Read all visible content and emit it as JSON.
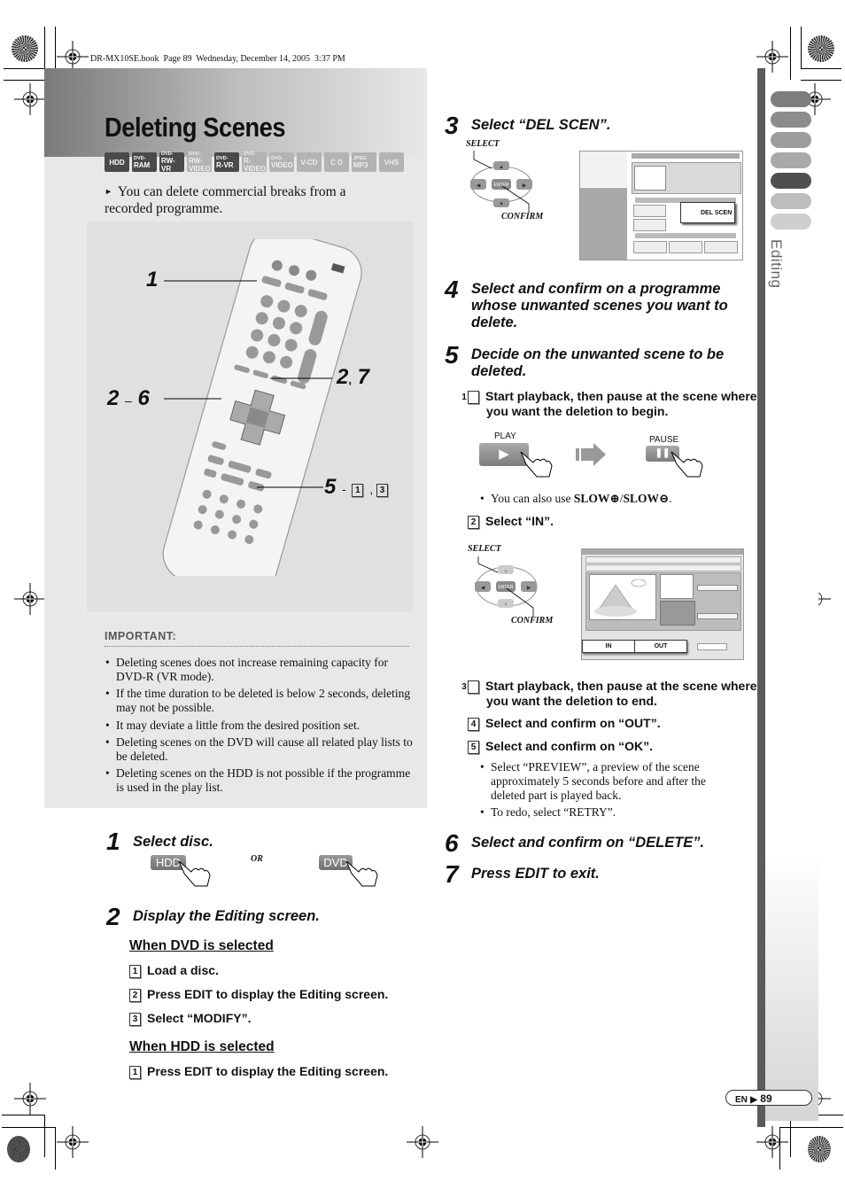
{
  "print_header": "DR-MX10SE.book  Page 89  Wednesday, December 14, 2005  3:37 PM",
  "title": "Deleting Scenes",
  "formats": [
    {
      "top": "",
      "label": "HDD",
      "active": true
    },
    {
      "top": "DVD-",
      "label": "RAM",
      "active": true
    },
    {
      "top": "DVD-",
      "label": "RW-VR",
      "active": true
    },
    {
      "top": "DVD-",
      "label": "RW-VIDEO",
      "active": false
    },
    {
      "top": "DVD-",
      "label": "R-VR",
      "active": true
    },
    {
      "top": "DVD-",
      "label": "R-VIDEO",
      "active": false
    },
    {
      "top": "DVD-",
      "label": "VIDEO",
      "active": false
    },
    {
      "top": "",
      "label": "V-CD",
      "active": false
    },
    {
      "top": "",
      "label": "C D",
      "active": false
    },
    {
      "top": "JPEG",
      "label": "MP3",
      "active": false
    },
    {
      "top": "",
      "label": "VHS",
      "active": false
    }
  ],
  "intro": "You can delete commercial breaks from a recorded programme.",
  "remote_callouts": {
    "c1": "1",
    "c27_a": "2",
    "c27_sep": ",",
    "c27_b": "7",
    "c26_a": "2",
    "c26_sep": "–",
    "c26_b": "6",
    "c5": "5",
    "c5_sep": "-",
    "c5_box1": "1",
    "c5_comma": ",",
    "c5_box2": "3"
  },
  "important": {
    "heading": "IMPORTANT:",
    "items": [
      "Deleting scenes does not increase remaining capacity for DVD-R (VR mode).",
      "If the time duration to be deleted is below 2 seconds, deleting may not be possible.",
      "It may deviate a little from the desired position set.",
      "Deleting scenes on the DVD will cause all related play lists to be deleted.",
      "Deleting scenes on the HDD is not possible if the programme is used in the play list."
    ]
  },
  "step1": {
    "num": "1",
    "title": "Select disc.",
    "btn_hdd": "HDD",
    "or": "OR",
    "btn_dvd": "DVD"
  },
  "step2": {
    "num": "2",
    "title": "Display the Editing screen.",
    "dvd_heading": "When DVD is selected",
    "dvd_items": [
      {
        "n": "1",
        "text": "Load a disc."
      },
      {
        "n": "2",
        "text": "Press EDIT to display the Editing screen."
      },
      {
        "n": "3",
        "text": "Select “MODIFY”."
      }
    ],
    "hdd_heading": "When HDD is selected",
    "hdd_items": [
      {
        "n": "1",
        "text": "Press EDIT to display the Editing screen."
      }
    ]
  },
  "step3": {
    "num": "3",
    "title": "Select “DEL SCEN”.",
    "select": "SELECT",
    "confirm": "CONFIRM",
    "enter": "ENTER",
    "popup": "DEL SCEN"
  },
  "step4": {
    "num": "4",
    "title": "Select and confirm on a programme whose unwanted scenes you want to delete."
  },
  "step5": {
    "num": "5",
    "title": "Decide on the unwanted scene to be deleted.",
    "s1": {
      "n": "1",
      "text": "Start playback, then pause at the scene where you want the deletion to begin."
    },
    "play": "PLAY",
    "pause": "PAUSE",
    "slow_note_pre": "You can also use ",
    "slow_note_b1": "SLOW⊕",
    "slow_note_mid": "/",
    "slow_note_b2": "SLOW⊖",
    "slow_note_end": ".",
    "s2": {
      "n": "2",
      "text": "Select “IN”."
    },
    "select": "SELECT",
    "confirm": "CONFIRM",
    "enter": "ENTER",
    "in_btn": "IN",
    "out_btn": "OUT",
    "s3": {
      "n": "3",
      "text": "Start playback, then pause at the scene where you want the deletion to end."
    },
    "s4": {
      "n": "4",
      "text": "Select and confirm on “OUT”."
    },
    "s5": {
      "n": "5",
      "text": "Select and confirm on “OK”."
    },
    "notes": [
      "Select “PREVIEW”, a preview of the scene approximately 5 seconds before and after the deleted part is played back.",
      "To redo, select “RETRY”."
    ]
  },
  "step6": {
    "num": "6",
    "title": "Select and confirm on “DELETE”."
  },
  "step7": {
    "num": "7",
    "title": "Press EDIT to exit."
  },
  "side_tab_label": "Editing",
  "side_tabs_active_index": 4,
  "page_footer": {
    "lang": "EN",
    "arrow": "▶",
    "page": "89"
  }
}
